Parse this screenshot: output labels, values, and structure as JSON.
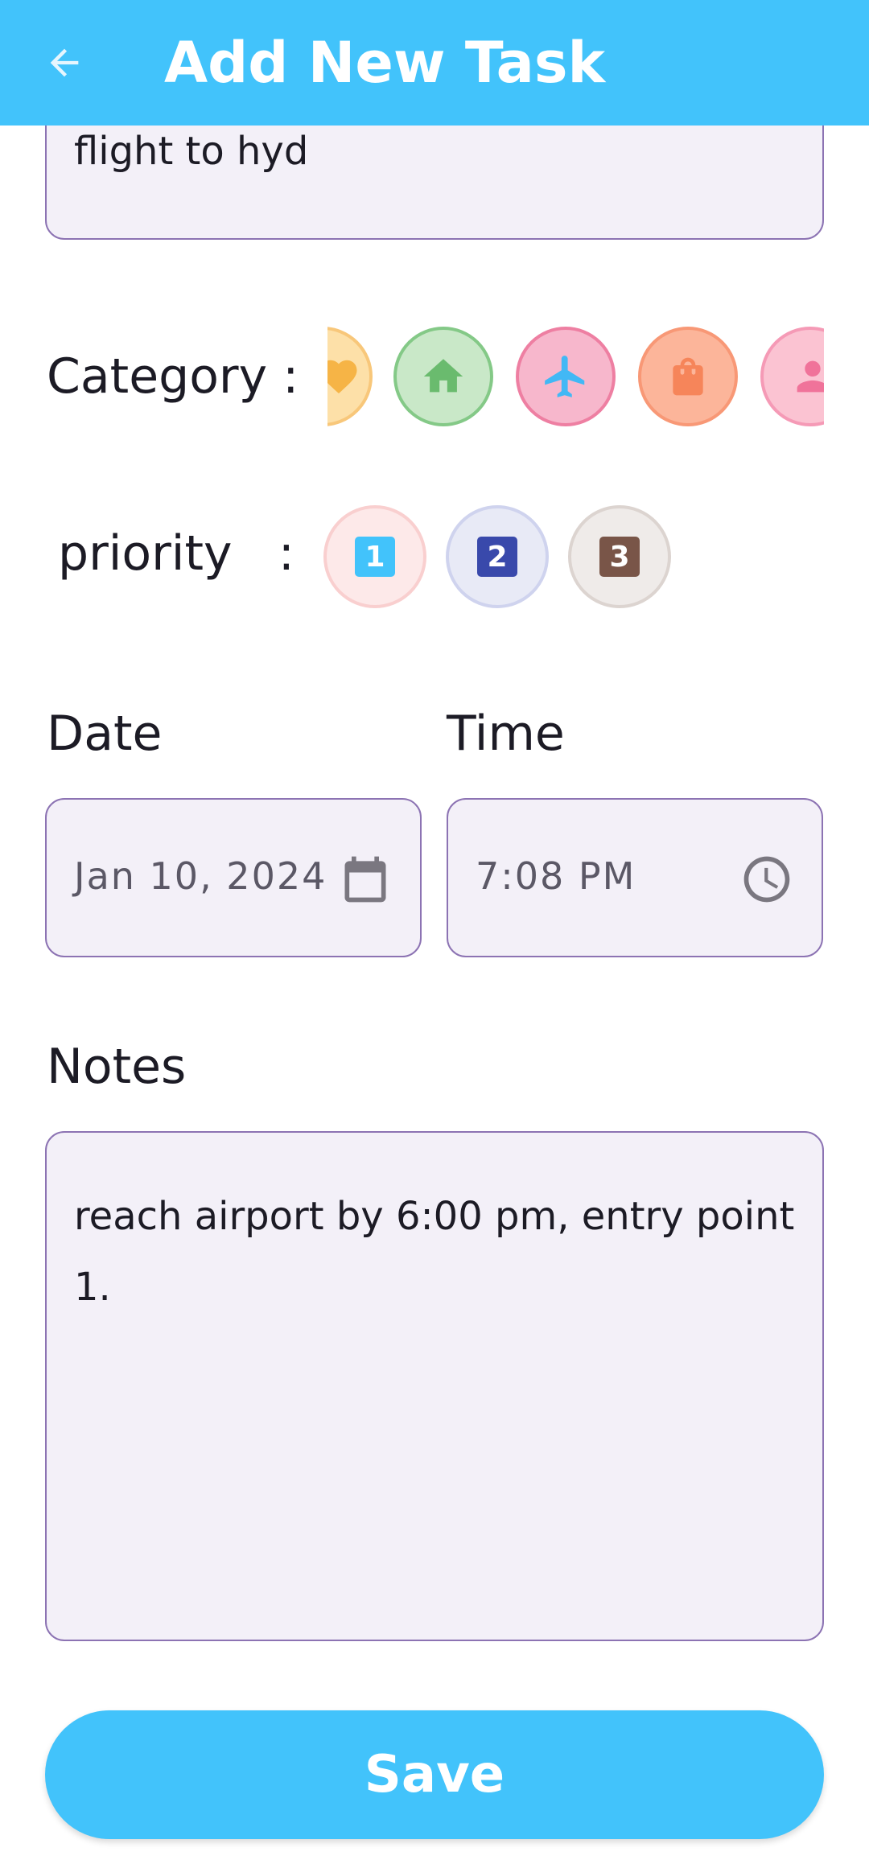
{
  "appbar": {
    "title": "Add New Task",
    "back_icon": "arrow-left-icon"
  },
  "title_field": {
    "value": "flight to hyd"
  },
  "category": {
    "label": "Category :",
    "items": [
      {
        "name": "heart",
        "icon": "heart-icon",
        "fill": "#fde0a8",
        "border": "#f8c77a",
        "iconColor": "#f6b446"
      },
      {
        "name": "home",
        "icon": "home-icon",
        "fill": "#c9e8c8",
        "border": "#84c987",
        "iconColor": "#6abb6e"
      },
      {
        "name": "travel",
        "icon": "airplane-icon",
        "fill": "#f7b7cc",
        "border": "#ee7fa2",
        "iconColor": "#42b8f5",
        "selected": true
      },
      {
        "name": "shopping",
        "icon": "shopping-bag-icon",
        "fill": "#fcb59a",
        "border": "#f89876",
        "iconColor": "#f6855a"
      },
      {
        "name": "person",
        "icon": "person-icon",
        "fill": "#fbc3d2",
        "border": "#f59ab6",
        "iconColor": "#f0739a"
      }
    ]
  },
  "priority": {
    "label": "priority   :",
    "items": [
      {
        "value": "1",
        "fill": "#fde9e9",
        "border": "#f9cfcf",
        "boxColor": "#42c3fb"
      },
      {
        "value": "2",
        "fill": "#e8eaf6",
        "border": "#cfd3ee",
        "boxColor": "#3949ab"
      },
      {
        "value": "3",
        "fill": "#efebe9",
        "border": "#dcd4d0",
        "boxColor": "#795548"
      }
    ]
  },
  "date": {
    "label": "Date",
    "value": "Jan 10, 2024",
    "icon": "calendar-icon"
  },
  "time": {
    "label": "Time",
    "value": "7:08 PM",
    "icon": "clock-icon"
  },
  "notes": {
    "label": "Notes",
    "value": "reach airport by 6:00 pm, entry point 1."
  },
  "save_button": {
    "label": "Save"
  },
  "colors": {
    "accent": "#42c3fb",
    "field_bg": "#f3f0f8",
    "field_border": "#8c73b3"
  }
}
